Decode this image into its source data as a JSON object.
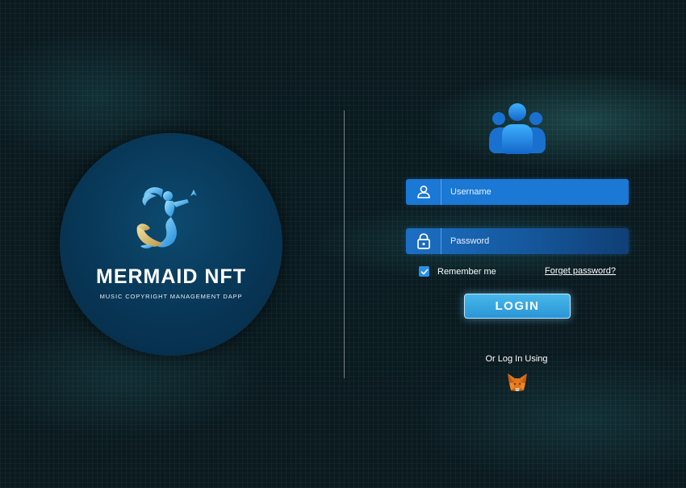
{
  "brand": {
    "name": "MERMAID NFT",
    "tagline": "MUSIC COPYRIGHT MANAGEMENT DAPP"
  },
  "login_form": {
    "username": {
      "placeholder": "Username",
      "value": "",
      "icon": "user-icon"
    },
    "password": {
      "placeholder": "Password",
      "value": "",
      "icon": "lock-icon"
    },
    "remember_me": {
      "label": "Remember me",
      "checked": true
    },
    "forgot_password_label": "Forget password?",
    "login_label": "LOGIN",
    "alt_login_text": "Or Log In Using",
    "alt_login_provider_icon": "metamask-fox-icon"
  },
  "colors": {
    "accent": "#1b78d4",
    "button": "#2b95d6",
    "background": "#0a1a1f"
  }
}
